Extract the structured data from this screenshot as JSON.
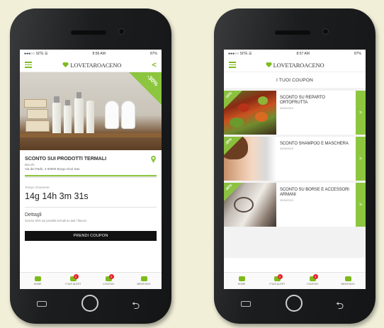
{
  "left": {
    "status": {
      "carrier": "●●●○○ SITE ☰",
      "time": "8:56 AM",
      "battery": "87%"
    },
    "header": {
      "logo": "LOVETAROACENO",
      "back": "<"
    },
    "hero": {
      "discount": "-30%"
    },
    "detail": {
      "title": "SCONTO SUI PRODOTTI TERMALI",
      "subtitle": "Bacchi",
      "address": "Via dei Padri, 4 00000 Borgo Alcol San",
      "timer_label": "Tempo rimanente",
      "timer": "14g 14h 3m 31s",
      "details_heading": "Dettagli",
      "details_text": "Sconto 30% sui prodotti termali su tutti i flaconi",
      "button": "PRENDI COUPON"
    }
  },
  "right": {
    "status": {
      "carrier": "●●●○○ SITE ☰",
      "time": "8:57 AM",
      "battery": "87%"
    },
    "header": {
      "logo": "LOVETAROACENO"
    },
    "list_title": "I TUOI COUPON",
    "coupons": [
      {
        "badge": "-10%",
        "title": "SCONTO SU REPARTO ORTOFRUTTA",
        "date": "30/06/2015",
        "arrow": ">"
      },
      {
        "badge": "-20%",
        "title": "SCONTO SHAMPOO E MASCHERA",
        "date": "30/06/2015",
        "arrow": ">"
      },
      {
        "badge": "-30%",
        "title": "SCONTO SU BORSE E ACCESSORI ARMANI",
        "date": "30/06/2015",
        "arrow": ">"
      }
    ]
  },
  "nav": {
    "items": [
      {
        "label": "HOME",
        "badge": ""
      },
      {
        "label": "I TUOI ALERT",
        "badge": "2"
      },
      {
        "label": "COUPON",
        "badge": "3"
      },
      {
        "label": "NEWS BOX",
        "badge": ""
      }
    ]
  },
  "colors": {
    "accent": "#8cc63f",
    "badge": "#e2232a",
    "button": "#111111"
  },
  "icons": [
    "hamburger-menu-icon",
    "heart-logo-icon",
    "location-pin-icon",
    "back-chevron-icon",
    "home-icon",
    "bell-icon",
    "coupon-icon",
    "mail-icon"
  ]
}
